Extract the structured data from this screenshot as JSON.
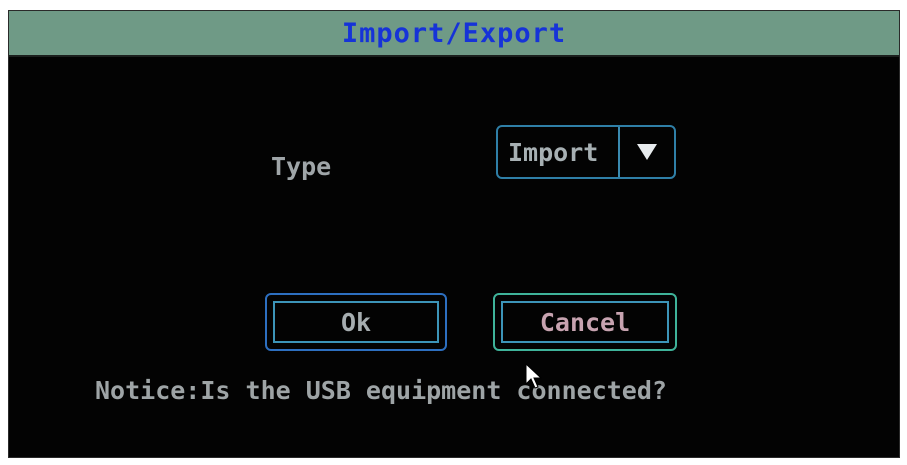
{
  "dialog": {
    "title": "Import/Export",
    "type_label": "Type",
    "type_select": {
      "value": "Import",
      "arrow_icon": "triangle-down-icon"
    },
    "ok_label": "Ok",
    "cancel_label": "Cancel",
    "notice": "Notice:Is the USB equipment connected?"
  },
  "colors": {
    "title_bar": "#6f9a86",
    "title_text": "#1633d8",
    "background": "#030303",
    "focus_border": "#3fb39a",
    "control_border": "#2f7fa7"
  },
  "cursor": {
    "icon": "mouse-pointer-icon"
  }
}
